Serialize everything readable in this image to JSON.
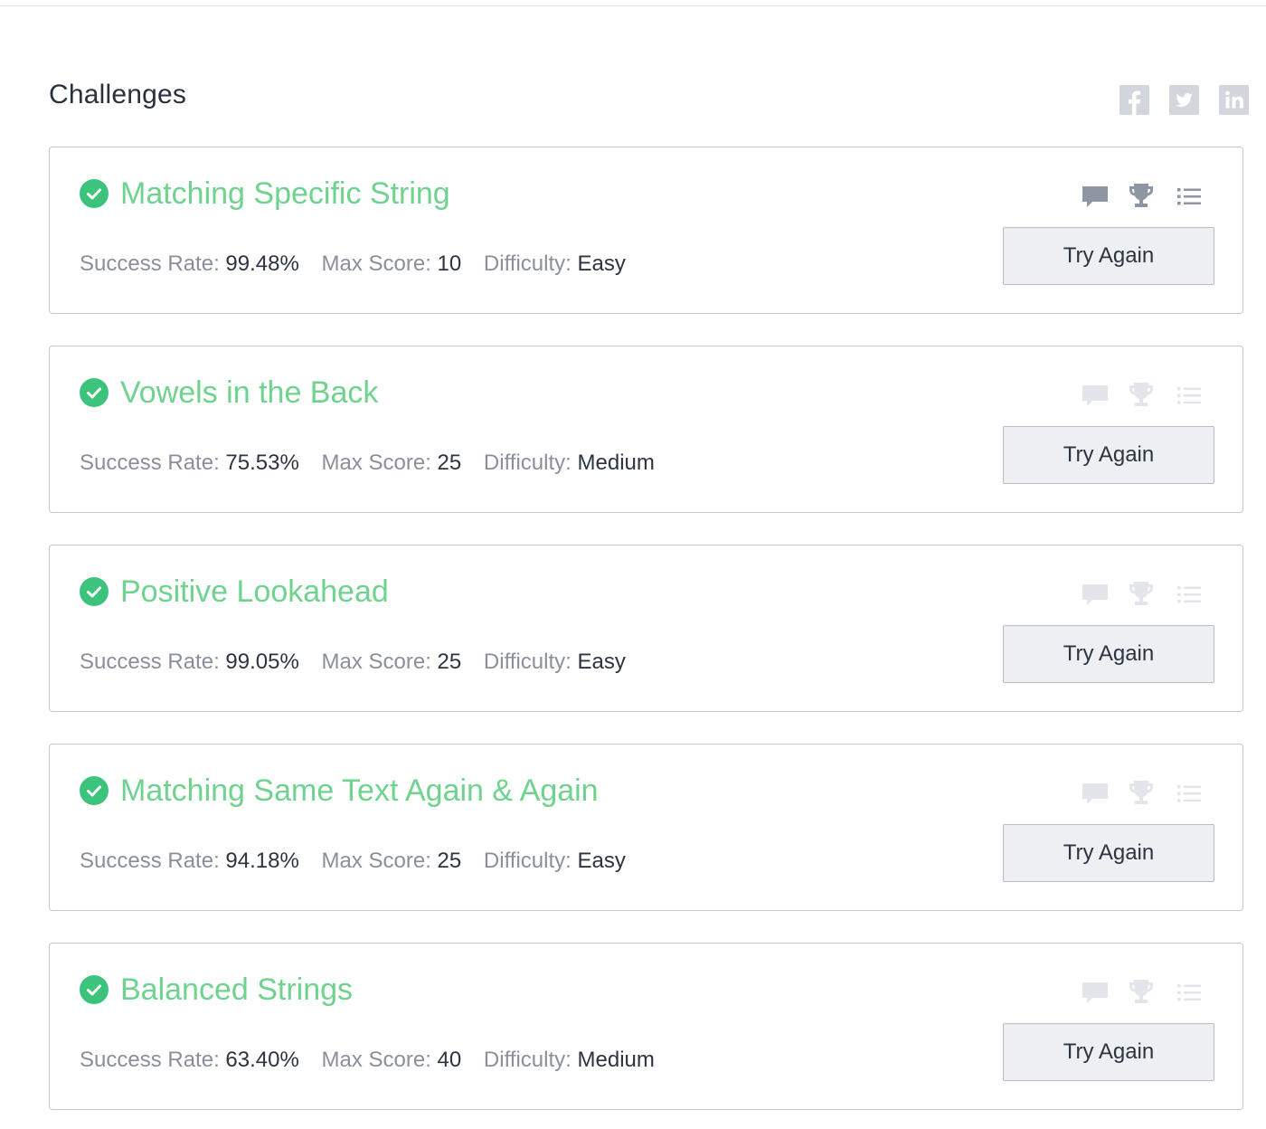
{
  "page": {
    "title": "Challenges",
    "social": [
      "facebook-icon",
      "twitter-icon",
      "linkedin-icon"
    ]
  },
  "colors": {
    "solved_green": "#6fd38f",
    "check_green": "#3cc47c",
    "icon_active": "#8e95a3",
    "icon_faded": "#e3e5ea"
  },
  "labels": {
    "success_rate": "Success Rate:",
    "max_score": "Max Score:",
    "difficulty": "Difficulty:"
  },
  "challenges": [
    {
      "title": "Matching Specific String",
      "success_rate": "99.48%",
      "max_score": "10",
      "difficulty": "Easy",
      "button": "Try Again"
    },
    {
      "title": "Vowels in the Back",
      "success_rate": "75.53%",
      "max_score": "25",
      "difficulty": "Medium",
      "button": "Try Again"
    },
    {
      "title": "Positive Lookahead",
      "success_rate": "99.05%",
      "max_score": "25",
      "difficulty": "Easy",
      "button": "Try Again"
    },
    {
      "title": "Matching Same Text Again & Again",
      "success_rate": "94.18%",
      "max_score": "25",
      "difficulty": "Easy",
      "button": "Try Again"
    },
    {
      "title": "Balanced Strings",
      "success_rate": "63.40%",
      "max_score": "40",
      "difficulty": "Medium",
      "button": "Try Again"
    }
  ]
}
